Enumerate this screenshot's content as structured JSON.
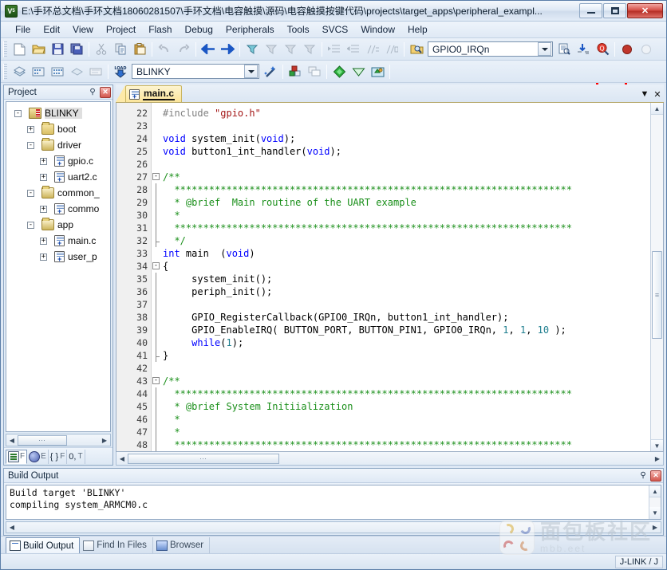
{
  "window": {
    "title": "E:\\手环总文档\\手环文档18060281507\\手环文档\\电容触摸\\源码\\电容触摸按键代码\\projects\\target_apps\\peripheral_exampl...",
    "app_icon": "keil-uvision-icon",
    "minimize_label": "Minimize",
    "maximize_label": "Maximize",
    "close_label": "✕"
  },
  "menu": {
    "items": [
      {
        "label": "File"
      },
      {
        "label": "Edit"
      },
      {
        "label": "View"
      },
      {
        "label": "Project"
      },
      {
        "label": "Flash"
      },
      {
        "label": "Debug"
      },
      {
        "label": "Peripherals"
      },
      {
        "label": "Tools"
      },
      {
        "label": "SVCS"
      },
      {
        "label": "Window"
      },
      {
        "label": "Help"
      }
    ]
  },
  "toolbar_main": {
    "buttons": [
      {
        "name": "new-file-icon",
        "tip": "New"
      },
      {
        "name": "open-file-icon",
        "tip": "Open"
      },
      {
        "name": "save-icon",
        "tip": "Save"
      },
      {
        "name": "save-all-icon",
        "tip": "Save All"
      },
      {
        "name": "cut-icon",
        "tip": "Cut"
      },
      {
        "name": "copy-icon",
        "tip": "Copy"
      },
      {
        "name": "paste-icon",
        "tip": "Paste"
      },
      {
        "name": "undo-icon",
        "tip": "Undo"
      },
      {
        "name": "redo-icon",
        "tip": "Redo"
      },
      {
        "name": "navigate-back-icon",
        "tip": "Back"
      },
      {
        "name": "navigate-forward-icon",
        "tip": "Forward"
      },
      {
        "name": "bookmark-toggle-icon",
        "tip": "Insert/Remove Bookmark"
      },
      {
        "name": "bookmark-prev-icon",
        "tip": "Previous Bookmark"
      },
      {
        "name": "bookmark-next-icon",
        "tip": "Next Bookmark"
      },
      {
        "name": "bookmark-clear-icon",
        "tip": "Clear All Bookmarks"
      },
      {
        "name": "indent-icon",
        "tip": "Indent"
      },
      {
        "name": "outdent-icon",
        "tip": "Outdent"
      },
      {
        "name": "comment-icon",
        "tip": "Comment"
      },
      {
        "name": "uncomment-icon",
        "tip": "Uncomment"
      },
      {
        "name": "find-in-files-icon",
        "tip": "Find in Files"
      }
    ],
    "find_combo": {
      "value": "GPIO0_IRQn",
      "placeholder": "",
      "dropdown_icon": "chevron-down-icon"
    },
    "after_find_buttons": [
      {
        "name": "find-in-files-2-icon",
        "tip": "Find in Files"
      },
      {
        "name": "browse-symbol-icon",
        "tip": "Browse Symbol"
      },
      {
        "name": "magnifier-search-icon",
        "tip": "Find"
      },
      {
        "name": "stop-build-icon",
        "tip": "Stop Build"
      },
      {
        "name": "inactive-circle-icon",
        "tip": ""
      }
    ],
    "highlight": {
      "target": "magnifier-search-icon",
      "color": "#ff0000"
    }
  },
  "toolbar_build": {
    "buttons": [
      {
        "name": "translate-icon",
        "tip": "Translate"
      },
      {
        "name": "build-icon",
        "tip": "Build"
      },
      {
        "name": "rebuild-icon",
        "tip": "Rebuild"
      },
      {
        "name": "batch-build-icon",
        "tip": "Batch Build"
      },
      {
        "name": "stop-build2-icon",
        "tip": "Stop Build"
      },
      {
        "name": "download-icon",
        "tip": "Download (LOAD)"
      }
    ],
    "target_combo": {
      "value": "BLINKY",
      "dropdown_icon": "chevron-down-icon"
    },
    "after_target_buttons": [
      {
        "name": "target-options-wand-icon",
        "tip": "Options for Target"
      },
      {
        "name": "manage-project-items-icon",
        "tip": "Manage Project Items"
      },
      {
        "name": "multi-project-icon",
        "tip": "Multi-Project"
      },
      {
        "name": "configure-flash-green-icon",
        "tip": "Configure Flash Tools"
      },
      {
        "name": "configure-flash-white-icon",
        "tip": "Configure"
      },
      {
        "name": "manage-run-environment-icon",
        "tip": "Manage Run-Time Environment"
      }
    ]
  },
  "project_panel": {
    "title": "Project",
    "pin_icon": "pin-icon",
    "close_icon": "close-icon",
    "tree": [
      {
        "depth": 0,
        "expander": "-",
        "icon": "project-icon",
        "label": "BLINKY",
        "selected": true
      },
      {
        "depth": 1,
        "expander": "+",
        "icon": "folder-icon",
        "label": "boot",
        "selected": false
      },
      {
        "depth": 1,
        "expander": "-",
        "icon": "folder-open-icon",
        "label": "driver",
        "selected": false
      },
      {
        "depth": 2,
        "expander": "+",
        "icon": "c-file-icon",
        "label": "gpio.c",
        "selected": false
      },
      {
        "depth": 2,
        "expander": "+",
        "icon": "c-file-icon",
        "label": "uart2.c",
        "selected": false
      },
      {
        "depth": 1,
        "expander": "-",
        "icon": "folder-open-icon",
        "label": "common_",
        "selected": false
      },
      {
        "depth": 2,
        "expander": "+",
        "icon": "c-file-icon",
        "label": "commo",
        "selected": false
      },
      {
        "depth": 1,
        "expander": "-",
        "icon": "folder-open-icon",
        "label": "app",
        "selected": false
      },
      {
        "depth": 2,
        "expander": "+",
        "icon": "c-file-icon",
        "label": "main.c",
        "selected": false
      },
      {
        "depth": 2,
        "expander": "+",
        "icon": "c-file-icon",
        "label": "user_p",
        "selected": false
      }
    ],
    "hscroll": {
      "left_arrow": "◀",
      "right_arrow": "▶",
      "thumb_glyph": "⋯"
    },
    "tabs": [
      {
        "label": "F",
        "icon": "project-tab-icon",
        "active": true,
        "name": "tab-project"
      },
      {
        "label": "E",
        "icon": "books-tab-icon",
        "active": false,
        "name": "tab-books"
      },
      {
        "label": "F",
        "icon": "functions-tab-icon",
        "active": false,
        "name": "tab-functions",
        "glyph": "{ }"
      },
      {
        "label": "T",
        "icon": "templates-tab-icon",
        "active": false,
        "name": "tab-templates",
        "glyph": "0,"
      }
    ]
  },
  "editor": {
    "tabs": [
      {
        "label": "main.c",
        "icon": "c-file-icon",
        "active": true
      }
    ],
    "tab_dropdown_icon": "chevron-down-icon",
    "tab_close_icon": "close-icon",
    "first_line_number": 22,
    "lines": [
      {
        "n": 22,
        "fold": "",
        "tokens": [
          {
            "t": "pp",
            "v": "#include"
          },
          {
            "t": "",
            "v": " "
          },
          {
            "t": "s",
            "v": "\"gpio.h\""
          }
        ]
      },
      {
        "n": 23,
        "fold": "",
        "tokens": []
      },
      {
        "n": 24,
        "fold": "",
        "tokens": [
          {
            "t": "k",
            "v": "void"
          },
          {
            "t": "",
            "v": " system_init("
          },
          {
            "t": "k",
            "v": "void"
          },
          {
            "t": "",
            "v": ");"
          }
        ]
      },
      {
        "n": 25,
        "fold": "",
        "tokens": [
          {
            "t": "k",
            "v": "void"
          },
          {
            "t": "",
            "v": " button1_int_handler("
          },
          {
            "t": "k",
            "v": "void"
          },
          {
            "t": "",
            "v": ");"
          }
        ]
      },
      {
        "n": 26,
        "fold": "",
        "tokens": []
      },
      {
        "n": 27,
        "fold": "-",
        "tokens": [
          {
            "t": "c",
            "v": "/**"
          }
        ]
      },
      {
        "n": 28,
        "fold": "|",
        "tokens": [
          {
            "t": "c",
            "v": "  *********************************************************************"
          }
        ]
      },
      {
        "n": 29,
        "fold": "|",
        "tokens": [
          {
            "t": "c",
            "v": "  * @brief  Main routine of the UART example"
          }
        ]
      },
      {
        "n": 30,
        "fold": "|",
        "tokens": [
          {
            "t": "c",
            "v": "  *"
          }
        ]
      },
      {
        "n": 31,
        "fold": "|",
        "tokens": [
          {
            "t": "c",
            "v": "  *********************************************************************"
          }
        ]
      },
      {
        "n": 32,
        "fold": "L",
        "tokens": [
          {
            "t": "c",
            "v": "  */"
          }
        ]
      },
      {
        "n": 33,
        "fold": "",
        "tokens": [
          {
            "t": "k",
            "v": "int"
          },
          {
            "t": "",
            "v": " main  ("
          },
          {
            "t": "k",
            "v": "void"
          },
          {
            "t": "",
            "v": ")"
          }
        ]
      },
      {
        "n": 34,
        "fold": "-",
        "tokens": [
          {
            "t": "",
            "v": "{"
          }
        ]
      },
      {
        "n": 35,
        "fold": "|",
        "tokens": [
          {
            "t": "",
            "v": "     system_init();"
          }
        ]
      },
      {
        "n": 36,
        "fold": "|",
        "tokens": [
          {
            "t": "",
            "v": "     periph_init();"
          }
        ]
      },
      {
        "n": 37,
        "fold": "|",
        "tokens": []
      },
      {
        "n": 38,
        "fold": "|",
        "tokens": [
          {
            "t": "",
            "v": "     GPIO_RegisterCallback(GPIO0_IRQn, button1_int_handler);"
          }
        ]
      },
      {
        "n": 39,
        "fold": "|",
        "tokens": [
          {
            "t": "",
            "v": "     GPIO_EnableIRQ( BUTTON_PORT, BUTTON_PIN1, GPIO0_IRQn, "
          },
          {
            "t": "n",
            "v": "1"
          },
          {
            "t": "",
            "v": ", "
          },
          {
            "t": "n",
            "v": "1"
          },
          {
            "t": "",
            "v": ", "
          },
          {
            "t": "n",
            "v": "10"
          },
          {
            "t": "",
            "v": " );"
          }
        ]
      },
      {
        "n": 40,
        "fold": "|",
        "tokens": [
          {
            "t": "",
            "v": "     "
          },
          {
            "t": "k",
            "v": "while"
          },
          {
            "t": "",
            "v": "("
          },
          {
            "t": "n",
            "v": "1"
          },
          {
            "t": "",
            "v": ");"
          }
        ]
      },
      {
        "n": 41,
        "fold": "L",
        "tokens": [
          {
            "t": "",
            "v": "}"
          }
        ]
      },
      {
        "n": 42,
        "fold": "",
        "tokens": []
      },
      {
        "n": 43,
        "fold": "-",
        "tokens": [
          {
            "t": "c",
            "v": "/**"
          }
        ]
      },
      {
        "n": 44,
        "fold": "|",
        "tokens": [
          {
            "t": "c",
            "v": "  *********************************************************************"
          }
        ]
      },
      {
        "n": 45,
        "fold": "|",
        "tokens": [
          {
            "t": "c",
            "v": "  * @brief System Initiialization"
          }
        ]
      },
      {
        "n": 46,
        "fold": "|",
        "tokens": [
          {
            "t": "c",
            "v": "  *"
          }
        ]
      },
      {
        "n": 47,
        "fold": "|",
        "tokens": [
          {
            "t": "c",
            "v": "  *"
          }
        ]
      },
      {
        "n": 48,
        "fold": "|",
        "tokens": [
          {
            "t": "c",
            "v": "  *********************************************************************"
          }
        ]
      }
    ],
    "vscroll": {
      "up_arrow": "▲",
      "down_arrow": "▼"
    },
    "hscroll": {
      "left_arrow": "◀",
      "right_arrow": "▶",
      "thumb_glyph": "⋯"
    }
  },
  "build_output": {
    "title": "Build Output",
    "pin_icon": "pin-icon",
    "close_icon": "close-icon",
    "text": "Build target 'BLINKY'\ncompiling system_ARMCM0.c",
    "vscroll": {
      "up_arrow": "▲",
      "down_arrow": "▼"
    },
    "hscroll": {
      "left_arrow": "◀",
      "right_arrow": "▶"
    }
  },
  "bottom_tabs": [
    {
      "label": "Build Output",
      "icon": "build-output-icon",
      "active": true,
      "name": "tab-build-output"
    },
    {
      "label": "Find In Files",
      "icon": "find-in-files-icon",
      "active": false,
      "name": "tab-find-in-files"
    },
    {
      "label": "Browser",
      "icon": "browser-icon",
      "active": false,
      "name": "tab-browser"
    }
  ],
  "statusbar": {
    "debugger": "J-LINK / J"
  },
  "watermark": {
    "chinese": "面包板社区",
    "english": "mbb.eet"
  },
  "colors": {
    "accent_blue": "#3a6fbf",
    "highlight_red": "#ff0000",
    "tab_yellow": "#fbe59a",
    "comment_green": "#1a8f1a",
    "keyword_blue": "#0000ff",
    "string_red": "#a31515",
    "number_teal": "#1f7f8f"
  }
}
